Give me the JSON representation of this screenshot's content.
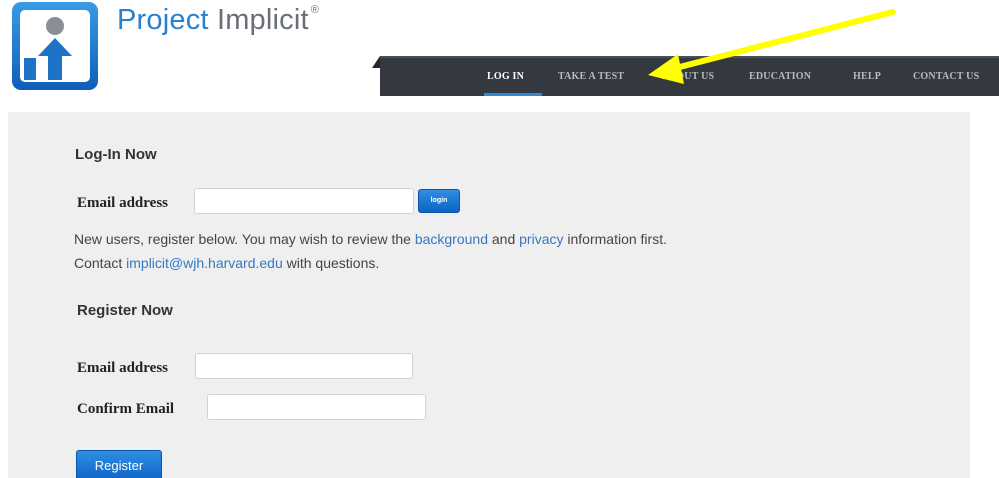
{
  "brand": {
    "logo_word1": "Project",
    "logo_word2": "Implicit",
    "logo_mark": "®",
    "primary_color": "#2b7fd1",
    "nav_bg_color": "#34393f",
    "annotation_color": "#ffff00"
  },
  "nav": {
    "items": [
      {
        "label": "LOG IN",
        "active": true
      },
      {
        "label": "TAKE A TEST",
        "active": false
      },
      {
        "label": "ABOUT US",
        "active": false
      },
      {
        "label": "EDUCATION",
        "active": false
      },
      {
        "label": "HELP",
        "active": false
      },
      {
        "label": "CONTACT US",
        "active": false
      }
    ]
  },
  "annotation": {
    "icon": "yellow-arrow-icon",
    "points_to": "TAKE A TEST"
  },
  "login": {
    "heading": "Log-In Now",
    "email_label": "Email address",
    "email_value": "",
    "email_placeholder": "",
    "button_label": "login"
  },
  "info": {
    "line1_prefix": "New users, register below. You may wish to review the ",
    "background_link": "background",
    "line1_middle": " and ",
    "privacy_link": "privacy",
    "line1_suffix": " information first.",
    "line2_prefix": "Contact ",
    "email_link": "implicit@wjh.harvard.edu",
    "line2_suffix": " with questions."
  },
  "register": {
    "heading": "Register Now",
    "email_label": "Email address",
    "email_value": "",
    "confirm_label": "Confirm Email",
    "confirm_value": "",
    "button_label": "Register"
  }
}
